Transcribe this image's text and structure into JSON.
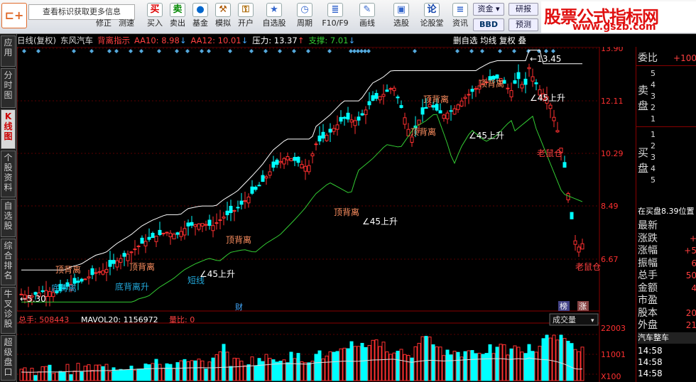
{
  "toolbar": {
    "logo_icon": "bracket-logo-icon",
    "hint": "查看标识获取更多信息",
    "buttons": [
      {
        "label": "修正",
        "icon": "star-icon"
      },
      {
        "label": "测速",
        "icon": "diamond-icon"
      },
      {
        "label": "买入",
        "icon": "buy-icon",
        "glyph": "买"
      },
      {
        "label": "卖出",
        "icon": "sell-icon",
        "glyph": "卖"
      },
      {
        "label": "基金",
        "icon": "fund-icon",
        "glyph": "●"
      },
      {
        "label": "模拟",
        "icon": "gavel-icon",
        "glyph": "⚒"
      },
      {
        "label": "开户",
        "icon": "lock-icon",
        "glyph": "🔒"
      },
      {
        "label": "自选股",
        "icon": "star-list-icon",
        "glyph": "★"
      },
      {
        "label": "周期",
        "icon": "clock-icon",
        "glyph": "◷"
      },
      {
        "label": "F10/F9",
        "icon": "info-doc-icon",
        "glyph": "≣"
      },
      {
        "label": "画线",
        "icon": "pen-icon",
        "glyph": "✎"
      },
      {
        "label": "选股",
        "icon": "monitor-icon",
        "glyph": "▣"
      },
      {
        "label": "论股堂",
        "icon": "forum-icon",
        "glyph": "论"
      },
      {
        "label": "资讯",
        "icon": "news-icon",
        "glyph": "≡"
      }
    ],
    "funds_label": "资金",
    "bbd_label": "BBD",
    "research_label": "研报",
    "forecast_label": "预测",
    "brand_title": "股票公式指标网",
    "brand_url": "www.gszb.com"
  },
  "left_tabs": [
    {
      "label": "应用",
      "active": false
    },
    {
      "label": "分时图",
      "active": false
    },
    {
      "label": "K线图",
      "active": true
    },
    {
      "label": "个股资料",
      "active": false
    },
    {
      "label": "自选股",
      "active": false
    },
    {
      "label": "综合排名",
      "active": false
    },
    {
      "label": "牛叉诊股",
      "active": false
    },
    {
      "label": "超级盘口",
      "active": false
    }
  ],
  "header": {
    "period": "日线(复权)",
    "stock": "东风汽车",
    "indicator": "背离指示",
    "aa10": "AA10: 8.98",
    "aa12": "AA12: 10.01",
    "pressure": "压力: 13.37",
    "support": "支撑: 7.01",
    "right_items": [
      "删自选",
      "均线",
      "复权",
      "叠"
    ]
  },
  "price_axis": [
    "13.90",
    "12.11",
    "10.29",
    "8.49",
    "6.67"
  ],
  "chart_annotations": {
    "high": "13.45",
    "low": "5.30",
    "top_div": "顶背离",
    "bottom_div": "底背离",
    "rise45": "45上升",
    "bottom_rise": "底背离升",
    "short_line": "短线",
    "old_rat": "老鼠仓",
    "cai": "财",
    "bang": "榜",
    "zhang": "涨"
  },
  "volume": {
    "total": "总手: 508443",
    "mavol": "MAVOL20: 1156972",
    "ratio": "量比: 0",
    "dropdown": "成交量",
    "axis": [
      "22003",
      "11001",
      "X100"
    ]
  },
  "right_panel": {
    "weibi": "委比",
    "weibi_val": "+100",
    "sell": "卖盘",
    "buy": "买盘",
    "levels_sell": [
      "5",
      "4",
      "3",
      "2",
      "1"
    ],
    "levels_buy": [
      "1",
      "2",
      "3",
      "4",
      "5"
    ],
    "position": "在买盘8.39位置",
    "fields": [
      {
        "label": "最新",
        "val": ""
      },
      {
        "label": "涨跌",
        "val": "+"
      },
      {
        "label": "涨幅",
        "val": "+5"
      },
      {
        "label": "振幅",
        "val": "6"
      },
      {
        "label": "总手",
        "val": "50"
      },
      {
        "label": "金额",
        "val": "4"
      },
      {
        "label": "市盈",
        "val": ""
      },
      {
        "label": "股本",
        "val": "20"
      },
      {
        "label": "外盘",
        "val": "21"
      }
    ],
    "industry": "汽车整车",
    "times": [
      "14:58",
      "14:58",
      "14:58",
      "14:58"
    ]
  },
  "colors": {
    "up": "#ff3030",
    "down": "#00ffff",
    "ma_white": "#ffffff",
    "ma_green": "#33cc33",
    "axis": "#aa0000"
  }
}
